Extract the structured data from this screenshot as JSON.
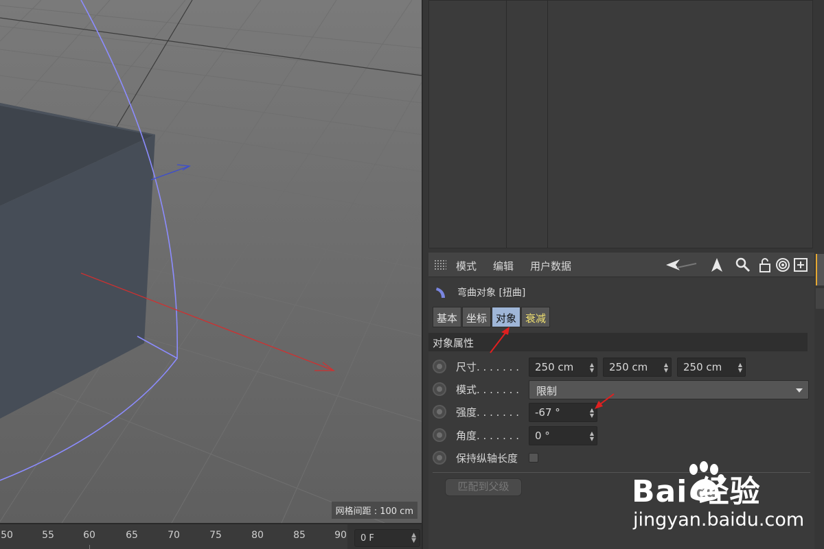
{
  "viewport": {
    "grid_spacing_label": "网格间距 : 100 cm"
  },
  "timeline": {
    "ticks": [
      "50",
      "55",
      "60",
      "65",
      "70",
      "75",
      "80",
      "85",
      "90"
    ],
    "frame_value": "0 F"
  },
  "attribute_manager": {
    "menu": {
      "mode": "模式",
      "edit": "编辑",
      "user_data": "用户数据"
    },
    "toolbar_icons": [
      "back-arrow-icon",
      "up-arrow-icon",
      "search-icon",
      "lock-icon",
      "target-icon",
      "new-panel-icon"
    ],
    "object_title": "弯曲对象 [扭曲]",
    "tabs": [
      {
        "label": "基本",
        "active": false
      },
      {
        "label": "坐标",
        "active": false
      },
      {
        "label": "对象",
        "active": true
      },
      {
        "label": "衰减",
        "active": false
      }
    ],
    "section_title": "对象属性",
    "properties": {
      "size": {
        "label": "尺寸. . . . . . .",
        "x": "250 cm",
        "y": "250 cm",
        "z": "250 cm"
      },
      "mode": {
        "label": "模式. . . . . . .",
        "value": "限制"
      },
      "strength": {
        "label": "强度. . . . . . .",
        "value": "-67 °"
      },
      "angle": {
        "label": "角度. . . . . . .",
        "value": "0 °"
      },
      "keep_length": {
        "label": "保持纵轴长度",
        "checked": false
      }
    },
    "match_parent_button": "匹配到父级"
  },
  "watermark": {
    "logo_text": "Bai  经验",
    "logo_du": "du",
    "url": "jingyan.baidu.com"
  },
  "colors": {
    "active_tab": "#9fb6d8",
    "annotation_arrow": "#e02020",
    "deformer_cage": "#8c8cff",
    "x_axis": "#d03030"
  }
}
